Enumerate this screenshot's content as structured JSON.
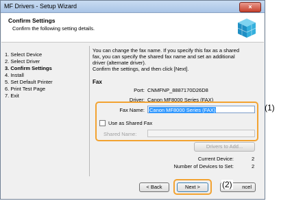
{
  "window": {
    "title": "MF Drivers - Setup Wizard",
    "close_icon": "×"
  },
  "header": {
    "title": "Confirm Settings",
    "subtitle": "Confirm the following setting details.",
    "icon": "installer-cube-icon"
  },
  "steps": [
    "1.  Select Device",
    "2.  Select Driver",
    "3.  Confirm Settings",
    "4.  Install",
    "5.  Set Default Printer",
    "6.  Print Test Page",
    "7.  Exit"
  ],
  "description_lines": [
    "You can change the fax name. If you specify this fax as a shared",
    "fax, you can specify the shared fax name and set an additional",
    "driver (alternate driver).",
    "Confirm the settings, and then click [Next]."
  ],
  "fax": {
    "heading": "Fax",
    "port_label": "Port:",
    "port_value": "CNMFNP_8887170D26D8",
    "driver_label": "Driver:",
    "driver_value": "Canon  MF8000 Series (FAX)",
    "fax_name_label": "Fax Name:",
    "fax_name_value": "Canon  MF8000 Series (FAX)",
    "shared_checkbox_label": "Use as Shared Fax",
    "shared_checked": false,
    "shared_name_label": "Shared Name:",
    "shared_name_value": "",
    "drivers_button": "Drivers to Add..."
  },
  "status": {
    "current_device_label": "Current Device:",
    "current_device_value": "2",
    "devices_to_set_label": "Number of Devices to Set:",
    "devices_to_set_value": "2"
  },
  "footer": {
    "back": "< Back",
    "next": "Next >",
    "cancel": "Cancel",
    "cancel_visible": "ncel"
  },
  "callouts": {
    "one": "(1)",
    "two": "(2)"
  },
  "colors": {
    "highlight": "#f2a230",
    "selection": "#3399ff",
    "title_bar": "#b9d1ee"
  }
}
